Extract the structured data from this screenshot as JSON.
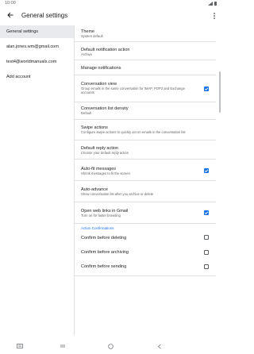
{
  "status": {
    "time": "10:00"
  },
  "appbar": {
    "title": "General settings"
  },
  "sidebar": {
    "items": [
      {
        "label": "General settings"
      },
      {
        "label": "alan.jones.wm@gmail.com"
      },
      {
        "label": "test4@worldmanuals.com"
      },
      {
        "label": "Add account"
      }
    ]
  },
  "settings": {
    "theme": {
      "title": "Theme",
      "sub": "System default"
    },
    "default_notification": {
      "title": "Default notification action",
      "sub": "Archive"
    },
    "manage_notifications": {
      "title": "Manage notifications"
    },
    "conversation_view": {
      "title": "Conversation view",
      "sub": "Group emails in the same conversation for IMAP, POP3 and Exchange accounts",
      "checked": true
    },
    "conversation_density": {
      "title": "Conversation list density",
      "sub": "Default"
    },
    "swipe_actions": {
      "title": "Swipe actions",
      "sub": "Configure swipe actions to quickly act on emails in the conversation list"
    },
    "default_reply": {
      "title": "Default reply action",
      "sub": "Choose your default reply action"
    },
    "auto_fit": {
      "title": "Auto-fit messages",
      "sub": "Shrink messages to fit the screen",
      "checked": true
    },
    "auto_advance": {
      "title": "Auto-advance",
      "sub": "Show conversation list after you archive or delete"
    },
    "open_web_links": {
      "title": "Open web links in Gmail",
      "sub": "Turn on for faster browsing",
      "checked": true
    },
    "action_confirmations": {
      "label": "Action Confirmations"
    },
    "confirm_deleting": {
      "title": "Confirm before deleting",
      "checked": false
    },
    "confirm_archiving": {
      "title": "Confirm before archiving",
      "checked": false
    },
    "confirm_sending": {
      "title": "Confirm before sending",
      "checked": false
    }
  },
  "colors": {
    "accent": "#1a73e8",
    "selected_bg": "#e8eaed",
    "divider": "#e0e0e0"
  },
  "icons": [
    "back-arrow-icon",
    "overflow-menu-icon",
    "checkbox-icon",
    "keyboard-icon",
    "recents-icon",
    "home-icon",
    "back-nav-icon"
  ]
}
